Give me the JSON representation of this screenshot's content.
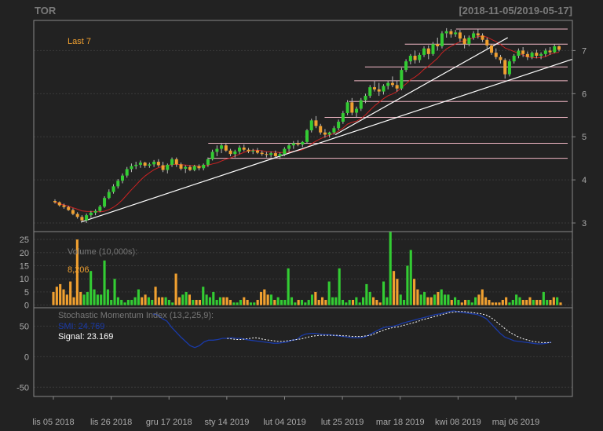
{
  "header": {
    "symbol": "TOR",
    "date_range": "[2018-11-05/2019-05-17]"
  },
  "colors": {
    "background": "#222222",
    "up_candle": "#33cc33",
    "down_candle": "#f0a030",
    "line": "#ffffff",
    "moving_average": "#cc2222",
    "fib_lines": "#f2b8c6",
    "smi_line": "#1a3aa8",
    "signal_line": "#ffffff",
    "grid": "#3a3a3a",
    "frame": "#888888",
    "axis_text": "#aaaaaa"
  },
  "chart_data": [
    {
      "type": "candlestick",
      "title": "",
      "legend": "Last 7",
      "ylim": [
        2.8,
        7.7
      ],
      "y_ticks": [
        3,
        4,
        5,
        6,
        7
      ],
      "candles": [
        [
          3.51,
          3.55,
          3.45,
          3.48
        ],
        [
          3.48,
          3.5,
          3.38,
          3.41
        ],
        [
          3.41,
          3.45,
          3.33,
          3.37
        ],
        [
          3.37,
          3.4,
          3.28,
          3.3
        ],
        [
          3.3,
          3.34,
          3.18,
          3.21
        ],
        [
          3.21,
          3.25,
          3.1,
          3.14
        ],
        [
          3.14,
          3.18,
          3.02,
          3.06
        ],
        [
          3.06,
          3.22,
          3.0,
          3.18
        ],
        [
          3.18,
          3.28,
          3.12,
          3.24
        ],
        [
          3.24,
          3.32,
          3.18,
          3.28
        ],
        [
          3.28,
          3.42,
          3.25,
          3.38
        ],
        [
          3.38,
          3.62,
          3.35,
          3.58
        ],
        [
          3.58,
          3.78,
          3.55,
          3.72
        ],
        [
          3.72,
          3.9,
          3.68,
          3.85
        ],
        [
          3.85,
          4.02,
          3.8,
          3.98
        ],
        [
          3.98,
          4.15,
          3.92,
          4.1
        ],
        [
          4.1,
          4.3,
          4.05,
          4.25
        ],
        [
          4.25,
          4.38,
          4.18,
          4.32
        ],
        [
          4.32,
          4.42,
          4.25,
          4.35
        ],
        [
          4.35,
          4.45,
          4.28,
          4.4
        ],
        [
          4.4,
          4.42,
          4.28,
          4.33
        ],
        [
          4.33,
          4.4,
          4.28,
          4.36
        ],
        [
          4.36,
          4.46,
          4.3,
          4.42
        ],
        [
          4.42,
          4.48,
          4.3,
          4.34
        ],
        [
          4.34,
          4.42,
          4.18,
          4.23
        ],
        [
          4.23,
          4.38,
          4.15,
          4.35
        ],
        [
          4.35,
          4.52,
          4.3,
          4.48
        ],
        [
          4.48,
          4.52,
          4.3,
          4.36
        ],
        [
          4.36,
          4.4,
          4.22,
          4.26
        ],
        [
          4.26,
          4.34,
          4.16,
          4.3
        ],
        [
          4.3,
          4.34,
          4.2,
          4.23
        ],
        [
          4.23,
          4.35,
          4.2,
          4.32
        ],
        [
          4.32,
          4.36,
          4.22,
          4.27
        ],
        [
          4.27,
          4.38,
          4.22,
          4.35
        ],
        [
          4.35,
          4.52,
          4.3,
          4.48
        ],
        [
          4.48,
          4.7,
          4.45,
          4.65
        ],
        [
          4.65,
          4.8,
          4.55,
          4.72
        ],
        [
          4.72,
          4.86,
          4.62,
          4.8
        ],
        [
          4.8,
          4.86,
          4.65,
          4.68
        ],
        [
          4.68,
          4.72,
          4.55,
          4.6
        ],
        [
          4.6,
          4.7,
          4.52,
          4.66
        ],
        [
          4.66,
          4.8,
          4.6,
          4.75
        ],
        [
          4.75,
          4.82,
          4.66,
          4.7
        ],
        [
          4.7,
          4.74,
          4.62,
          4.66
        ],
        [
          4.66,
          4.72,
          4.6,
          4.68
        ],
        [
          4.68,
          4.74,
          4.6,
          4.63
        ],
        [
          4.63,
          4.68,
          4.56,
          4.6
        ],
        [
          4.6,
          4.65,
          4.52,
          4.58
        ],
        [
          4.58,
          4.66,
          4.52,
          4.62
        ],
        [
          4.62,
          4.68,
          4.5,
          4.55
        ],
        [
          4.55,
          4.64,
          4.48,
          4.6
        ],
        [
          4.6,
          4.76,
          4.55,
          4.72
        ],
        [
          4.72,
          4.85,
          4.65,
          4.8
        ],
        [
          4.8,
          4.9,
          4.72,
          4.85
        ],
        [
          4.85,
          4.92,
          4.78,
          4.82
        ],
        [
          4.82,
          4.9,
          4.76,
          4.88
        ],
        [
          4.88,
          5.18,
          4.85,
          5.15
        ],
        [
          5.15,
          5.42,
          5.1,
          5.38
        ],
        [
          5.38,
          5.48,
          5.2,
          5.25
        ],
        [
          5.25,
          5.3,
          5.05,
          5.1
        ],
        [
          5.1,
          5.18,
          4.98,
          5.05
        ],
        [
          5.05,
          5.12,
          4.98,
          5.1
        ],
        [
          5.1,
          5.25,
          5.05,
          5.2
        ],
        [
          5.2,
          5.4,
          5.15,
          5.35
        ],
        [
          5.35,
          5.6,
          5.3,
          5.55
        ],
        [
          5.55,
          5.85,
          5.5,
          5.8
        ],
        [
          5.8,
          5.9,
          5.5,
          5.56
        ],
        [
          5.56,
          5.7,
          5.45,
          5.65
        ],
        [
          5.65,
          5.9,
          5.6,
          5.85
        ],
        [
          5.85,
          6.0,
          5.78,
          5.95
        ],
        [
          5.95,
          6.2,
          5.9,
          6.15
        ],
        [
          6.15,
          6.3,
          6.05,
          6.1
        ],
        [
          6.1,
          6.25,
          5.95,
          6.05
        ],
        [
          6.05,
          6.22,
          5.98,
          6.18
        ],
        [
          6.18,
          6.3,
          6.1,
          6.25
        ],
        [
          6.25,
          6.4,
          6.15,
          6.2
        ],
        [
          6.2,
          6.3,
          6.05,
          6.12
        ],
        [
          6.12,
          6.6,
          6.08,
          6.55
        ],
        [
          6.55,
          6.8,
          6.5,
          6.75
        ],
        [
          6.75,
          6.92,
          6.68,
          6.88
        ],
        [
          6.88,
          7.0,
          6.7,
          6.78
        ],
        [
          6.78,
          6.95,
          6.72,
          6.9
        ],
        [
          6.9,
          7.1,
          6.85,
          7.05
        ],
        [
          7.05,
          7.12,
          6.8,
          6.92
        ],
        [
          6.92,
          7.2,
          6.88,
          7.15
        ],
        [
          7.15,
          7.3,
          7.0,
          7.1
        ],
        [
          7.1,
          7.45,
          7.05,
          7.4
        ],
        [
          7.4,
          7.52,
          7.3,
          7.45
        ],
        [
          7.45,
          7.5,
          7.3,
          7.38
        ],
        [
          7.38,
          7.48,
          7.32,
          7.42
        ],
        [
          7.42,
          7.48,
          7.2,
          7.28
        ],
        [
          7.28,
          7.35,
          7.05,
          7.15
        ],
        [
          7.15,
          7.35,
          7.1,
          7.3
        ],
        [
          7.3,
          7.45,
          7.25,
          7.4
        ],
        [
          7.4,
          7.5,
          7.28,
          7.35
        ],
        [
          7.35,
          7.4,
          7.2,
          7.25
        ],
        [
          7.25,
          7.3,
          7.05,
          7.12
        ],
        [
          7.12,
          7.15,
          6.9,
          6.95
        ],
        [
          6.95,
          7.05,
          6.8,
          6.85
        ],
        [
          6.85,
          6.9,
          6.7,
          6.78
        ],
        [
          6.78,
          6.82,
          6.35,
          6.45
        ],
        [
          6.45,
          6.8,
          6.4,
          6.75
        ],
        [
          6.75,
          6.92,
          6.7,
          6.88
        ],
        [
          6.88,
          7.05,
          6.82,
          7.0
        ],
        [
          7.0,
          7.08,
          6.85,
          6.92
        ],
        [
          6.92,
          6.98,
          6.78,
          6.85
        ],
        [
          6.85,
          6.98,
          6.8,
          6.95
        ],
        [
          6.95,
          7.02,
          6.82,
          6.88
        ],
        [
          6.88,
          6.96,
          6.8,
          6.92
        ],
        [
          6.92,
          7.05,
          6.86,
          7.0
        ],
        [
          7.0,
          7.08,
          6.9,
          6.96
        ],
        [
          6.96,
          7.15,
          6.94,
          7.1
        ],
        [
          7.1,
          7.12,
          6.98,
          7.02
        ]
      ],
      "fib_lines": [
        {
          "y": 7.5,
          "from": 0.784
        },
        {
          "y": 7.15,
          "from": 0.689
        },
        {
          "y": 6.62,
          "from": 0.615
        },
        {
          "y": 6.3,
          "from": 0.595
        },
        {
          "y": 5.82,
          "from": 0.585
        },
        {
          "y": 5.45,
          "from": 0.54
        },
        {
          "y": 4.85,
          "from": 0.324
        },
        {
          "y": 4.5,
          "from": 0.324
        }
      ],
      "trendlines": [
        {
          "x1": 0.0875,
          "y1": 3.02,
          "x2": 1.0,
          "y2": 6.8
        },
        {
          "x1": 0.56,
          "y1": 5.05,
          "x2": 0.88,
          "y2": 7.3
        }
      ]
    },
    {
      "type": "bar",
      "title": "Volume (10,000s):",
      "last_value_label": "8,206",
      "ylim": [
        -1,
        28
      ],
      "y_ticks": [
        0,
        5,
        10,
        15,
        20,
        25
      ],
      "values": [
        5,
        7,
        8,
        6,
        4,
        9,
        3,
        25,
        5,
        4,
        5,
        13,
        6,
        4,
        4,
        17,
        6,
        2,
        10,
        3,
        2,
        1,
        2,
        2,
        3,
        6,
        3,
        4,
        3,
        2,
        7,
        3,
        3,
        3,
        2,
        1,
        12,
        3,
        4,
        5,
        4,
        2,
        2,
        2,
        7,
        4,
        3,
        5,
        2,
        3,
        3,
        3,
        2,
        1,
        1,
        2,
        3,
        2,
        1,
        1,
        2,
        5,
        6,
        4,
        4,
        2,
        3,
        2,
        2,
        14,
        3,
        1,
        2,
        2,
        1,
        2,
        4,
        5,
        2,
        3,
        2,
        9,
        3,
        3,
        14,
        2,
        1,
        2,
        2,
        3,
        1,
        3,
        8,
        5,
        3,
        2,
        1,
        9,
        3,
        28,
        13,
        10,
        4,
        2,
        15,
        21,
        10,
        6,
        4,
        5,
        3,
        3,
        4,
        5,
        6,
        4,
        4,
        2,
        3,
        2,
        1,
        2,
        2,
        1,
        3,
        4,
        6,
        3,
        2,
        1,
        1,
        1,
        2,
        3,
        1,
        2,
        4,
        3,
        2,
        2,
        3,
        2,
        2,
        2,
        5,
        2,
        2,
        3,
        3,
        1
      ],
      "up": []
    },
    {
      "type": "line",
      "title": "Stochastic Momentum Index (13,2,25,9):",
      "ylim": [
        -65,
        80
      ],
      "y_ticks": [
        -50,
        0,
        50
      ],
      "series": [
        {
          "name": "SMI",
          "label": "SMI: 24.769",
          "values": [
            70,
            68,
            62,
            58,
            48,
            40,
            32,
            25,
            18,
            15,
            18,
            24,
            27,
            27,
            28,
            30,
            30,
            31,
            30,
            30,
            28,
            27,
            26,
            25,
            24,
            23,
            22,
            22,
            23,
            24,
            27,
            28,
            34,
            37,
            38,
            38,
            37,
            36,
            36,
            35,
            34,
            33,
            32,
            31,
            31,
            31,
            33,
            37,
            41,
            45,
            48,
            49,
            50,
            52,
            55,
            57,
            59,
            61,
            63,
            65,
            67,
            69,
            70,
            72,
            74,
            75,
            73,
            72,
            71,
            70,
            69,
            66,
            62,
            54,
            46,
            38,
            32,
            29,
            26,
            25,
            24,
            23,
            22,
            21,
            21,
            22,
            24
          ]
        },
        {
          "name": "Signal",
          "label": "Signal: 23.169",
          "values": [
            null,
            null,
            null,
            null,
            null,
            null,
            null,
            null,
            null,
            null,
            null,
            null,
            null,
            null,
            null,
            null,
            30,
            29,
            28,
            28,
            29,
            30,
            31,
            30,
            28,
            27,
            26,
            25,
            25,
            26,
            27,
            28,
            29,
            31,
            33,
            34,
            35,
            35,
            35,
            35,
            35,
            34,
            34,
            33,
            33,
            33,
            34,
            35,
            38,
            41,
            44,
            46,
            48,
            49,
            51,
            53,
            55,
            57,
            60,
            62,
            64,
            66,
            68,
            70,
            72,
            73,
            74,
            74,
            73,
            72,
            71,
            70,
            68,
            64,
            58,
            52,
            46,
            40,
            36,
            32,
            29,
            27,
            25,
            24,
            23,
            23,
            23
          ]
        }
      ]
    }
  ],
  "x_axis": {
    "tick_labels": [
      "lis 05 2018",
      "lis 26 2018",
      "gru 17 2018",
      "sty 14 2019",
      "lut 04 2019",
      "lut 25 2019",
      "mar 18 2019",
      "kwi 08 2019",
      "maj 06 2019"
    ]
  }
}
